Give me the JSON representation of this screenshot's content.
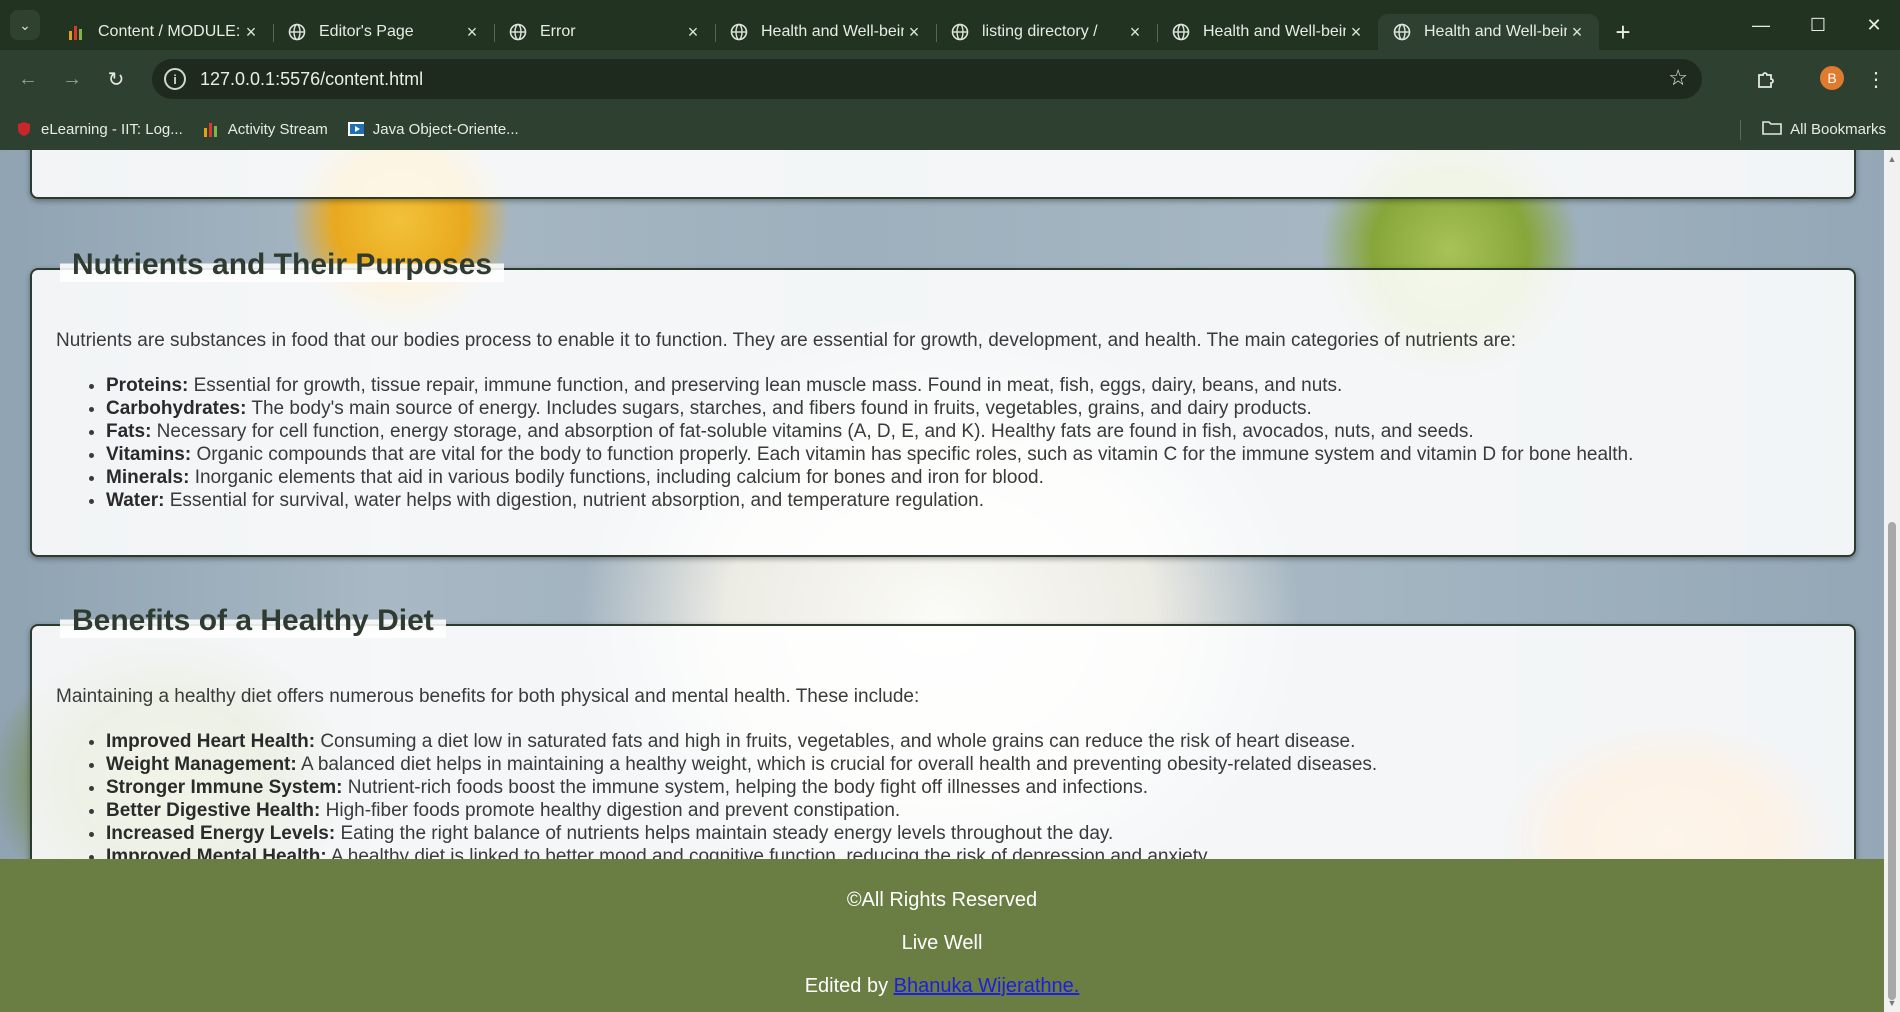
{
  "browser": {
    "tabs": [
      {
        "title": "Content / MODULE: ("
      },
      {
        "title": "Editor's Page"
      },
      {
        "title": "Error"
      },
      {
        "title": "Health and Well-bein"
      },
      {
        "title": "listing directory /"
      },
      {
        "title": "Health and Well-bein"
      },
      {
        "title": "Health and Well-bein"
      }
    ],
    "url": "127.0.0.1:5576/content.html",
    "profile_initial": "B",
    "bookmarks": [
      {
        "label": "eLearning - IIT: Log..."
      },
      {
        "label": "Activity Stream"
      },
      {
        "label": "Java Object-Oriente..."
      }
    ],
    "all_bookmarks": "All Bookmarks"
  },
  "page": {
    "nutrients": {
      "heading": "Nutrients and Their Purposes",
      "intro": "Nutrients are substances in food that our bodies process to enable it to function. They are essential for growth, development, and health. The main categories of nutrients are:",
      "items": [
        {
          "term": "Proteins:",
          "text": " Essential for growth, tissue repair, immune function, and preserving lean muscle mass. Found in meat, fish, eggs, dairy, beans, and nuts."
        },
        {
          "term": "Carbohydrates:",
          "text": " The body's main source of energy. Includes sugars, starches, and fibers found in fruits, vegetables, grains, and dairy products."
        },
        {
          "term": "Fats:",
          "text": " Necessary for cell function, energy storage, and absorption of fat-soluble vitamins (A, D, E, and K). Healthy fats are found in fish, avocados, nuts, and seeds."
        },
        {
          "term": "Vitamins:",
          "text": " Organic compounds that are vital for the body to function properly. Each vitamin has specific roles, such as vitamin C for the immune system and vitamin D for bone health."
        },
        {
          "term": "Minerals:",
          "text": " Inorganic elements that aid in various bodily functions, including calcium for bones and iron for blood."
        },
        {
          "term": "Water:",
          "text": " Essential for survival, water helps with digestion, nutrient absorption, and temperature regulation."
        }
      ]
    },
    "benefits": {
      "heading": "Benefits of a Healthy Diet",
      "intro": "Maintaining a healthy diet offers numerous benefits for both physical and mental health. These include:",
      "items": [
        {
          "term": "Improved Heart Health:",
          "text": " Consuming a diet low in saturated fats and high in fruits, vegetables, and whole grains can reduce the risk of heart disease."
        },
        {
          "term": "Weight Management:",
          "text": " A balanced diet helps in maintaining a healthy weight, which is crucial for overall health and preventing obesity-related diseases."
        },
        {
          "term": "Stronger Immune System:",
          "text": " Nutrient-rich foods boost the immune system, helping the body fight off illnesses and infections."
        },
        {
          "term": "Better Digestive Health:",
          "text": " High-fiber foods promote healthy digestion and prevent constipation."
        },
        {
          "term": "Increased Energy Levels:",
          "text": " Eating the right balance of nutrients helps maintain steady energy levels throughout the day."
        },
        {
          "term": "Improved Mental Health:",
          "text": " A healthy diet is linked to better mood and cognitive function, reducing the risk of depression and anxiety."
        }
      ]
    }
  },
  "footer": {
    "rights": "©All Rights Reserved",
    "slogan": "Live Well",
    "edited_prefix": "Edited by ",
    "author_link": "Bhanuka Wijerathne."
  },
  "colors": {
    "chrome_dark": "#223322",
    "chrome": "#2e402f",
    "footer_bg": "#6a7d42",
    "link": "#1e1ee0"
  }
}
